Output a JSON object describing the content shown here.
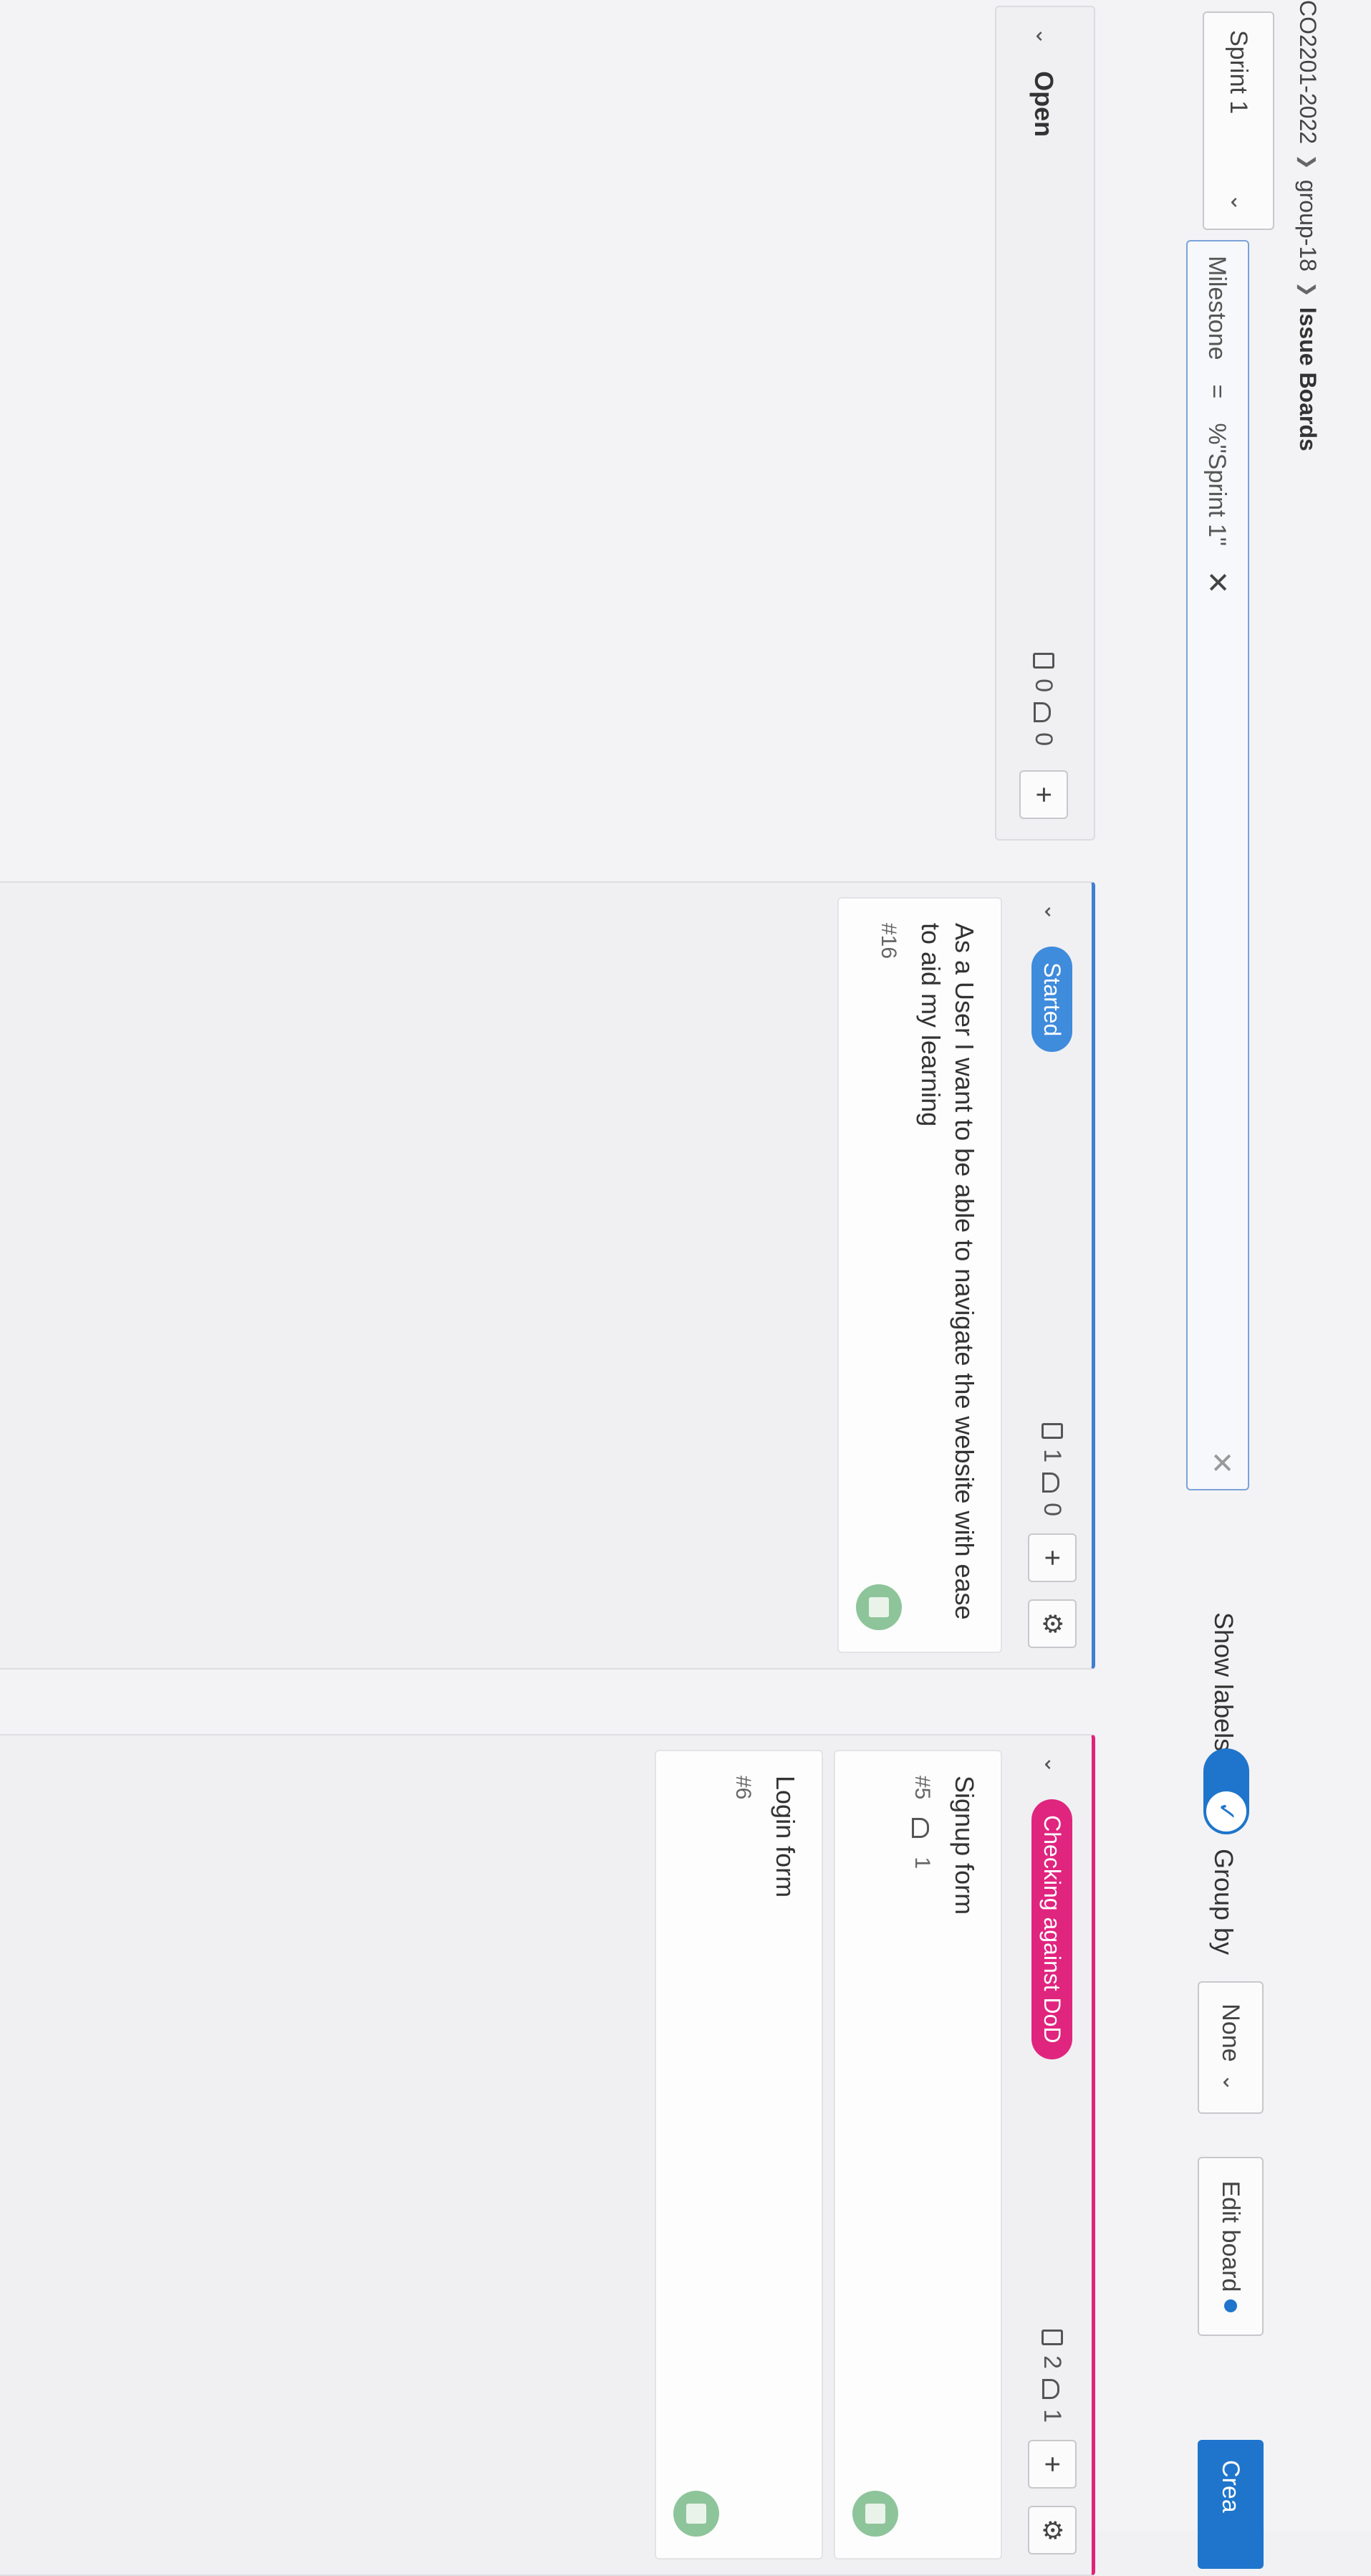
{
  "breadcrumb": {
    "items": [
      "CO2201-2022",
      "group-18",
      "Issue Boards"
    ]
  },
  "filters": {
    "sprint_select": "Sprint 1",
    "token_field": "Milestone",
    "token_operator": "=",
    "token_value": "%\"Sprint 1\"",
    "show_labels": "Show labels",
    "group_by": "Group by",
    "group_by_value": "None",
    "edit_board": "Edit board",
    "create_button": "Crea"
  },
  "lists": {
    "open": {
      "title": "Open",
      "issues": "0",
      "weight": "0"
    },
    "started": {
      "label": "Started",
      "issues": "1",
      "weight": "0",
      "cards": [
        {
          "title": "As a User I want to be able to navigate the website with ease to aid my learning",
          "id": "#16"
        }
      ]
    },
    "dod": {
      "label": "Checking against DoD",
      "issues": "2",
      "weight": "1",
      "cards": [
        {
          "title": "Signup form",
          "id": "#5",
          "weight": "1"
        },
        {
          "title": "Login form",
          "id": "#6"
        }
      ]
    }
  },
  "colors": {
    "accent": "#1f75cb",
    "started": "#3f8bdc",
    "dod": "#e0257f"
  }
}
